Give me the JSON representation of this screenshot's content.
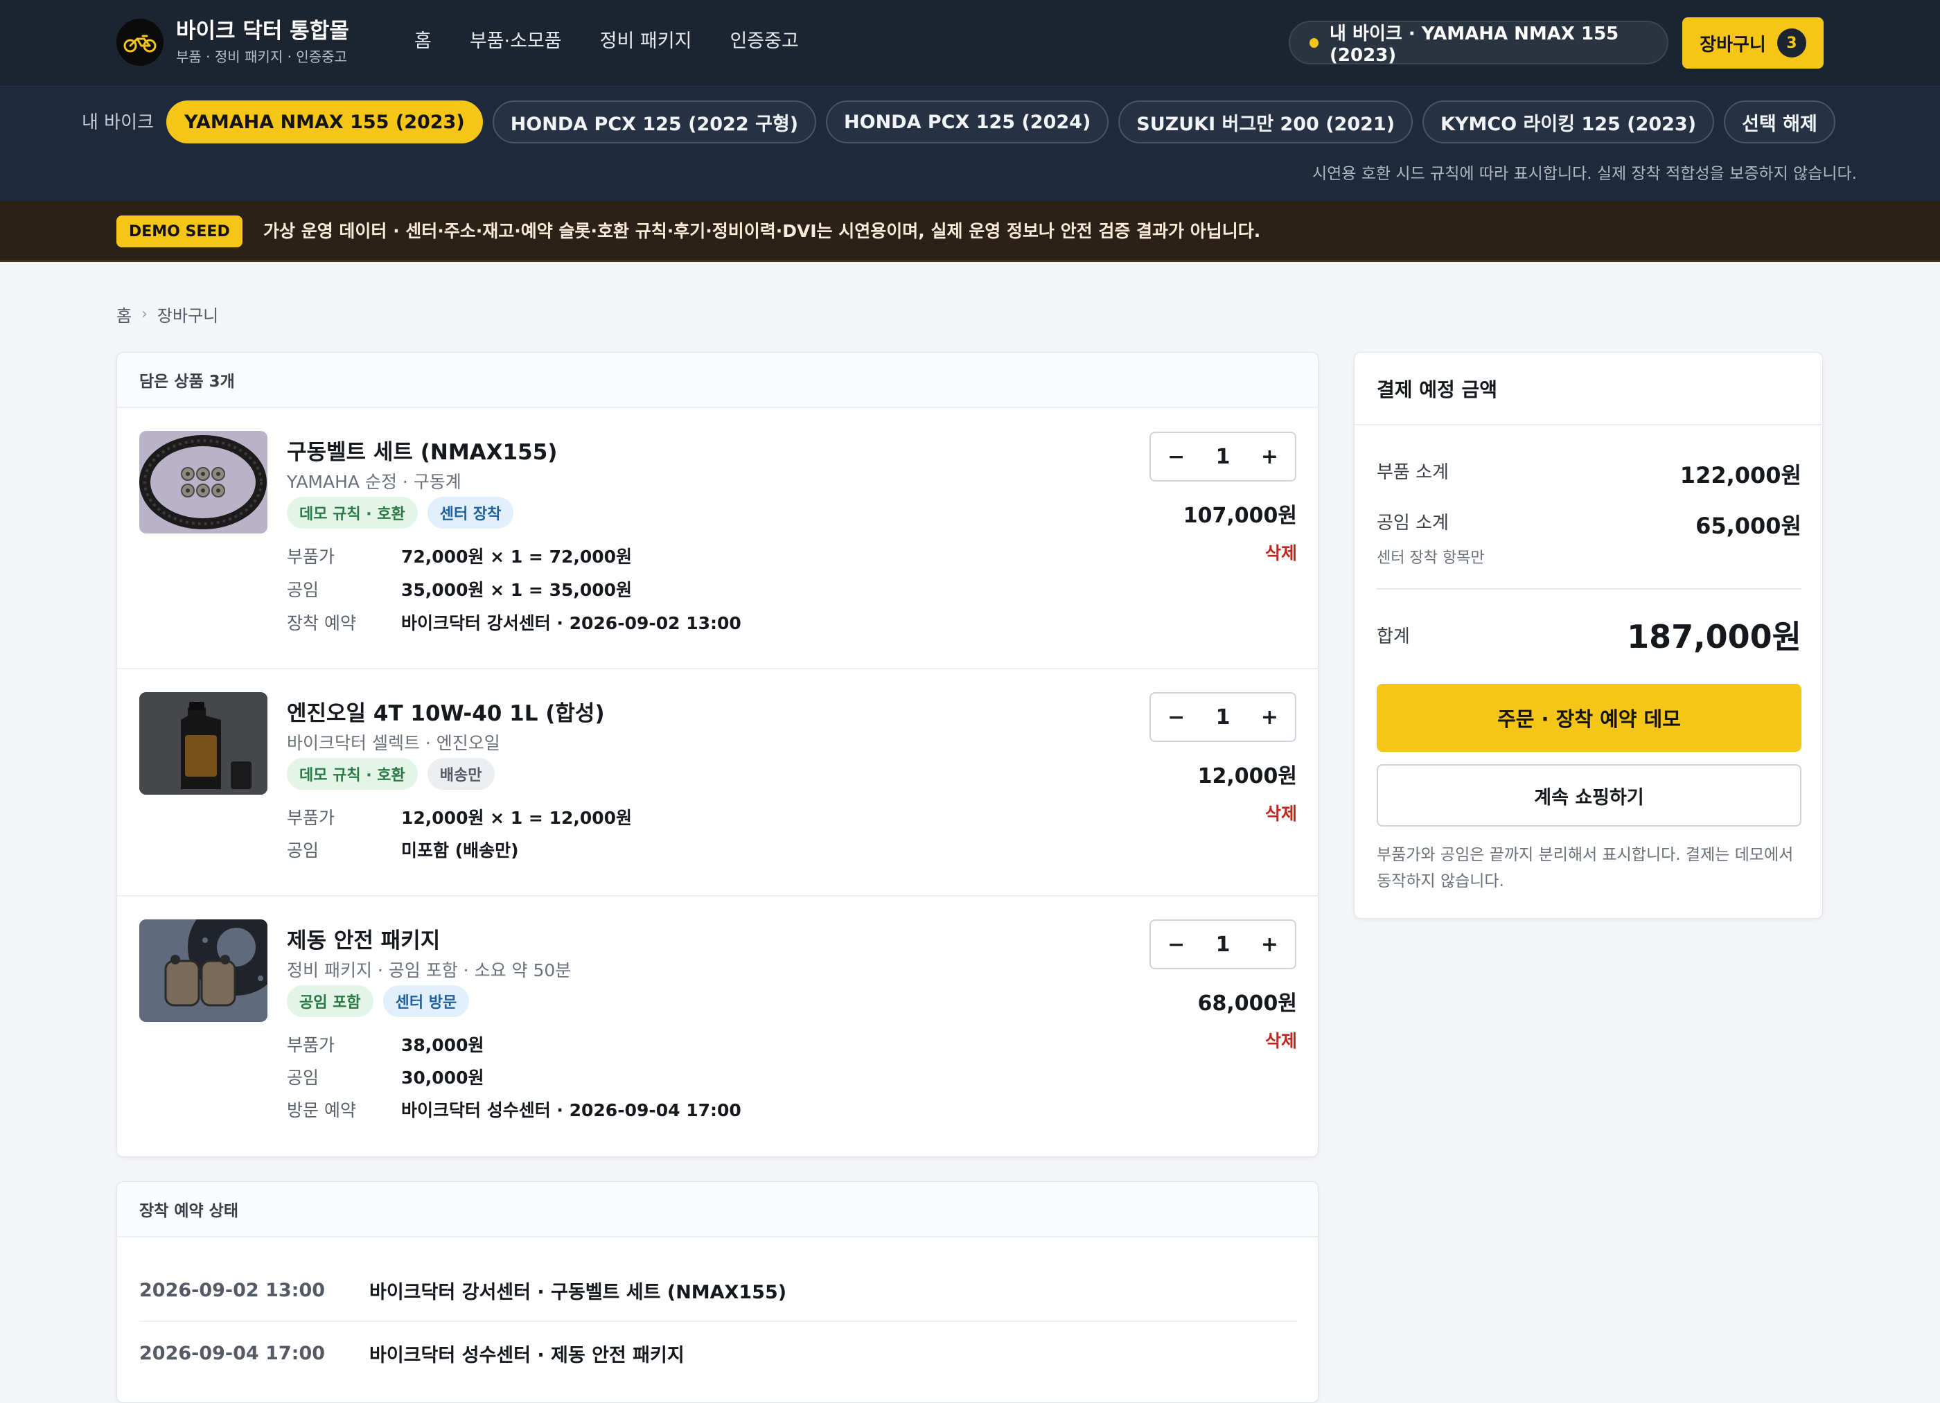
{
  "header": {
    "brand_title": "바이크 닥터 통합몰",
    "brand_sub": "부품 · 정비 패키지 · 인증중고",
    "nav": [
      "홈",
      "부품·소모품",
      "정비 패키지",
      "인증중고"
    ],
    "my_bike_pill": "내 바이크 · YAMAHA NMAX 155 (2023)",
    "cart_label": "장바구니",
    "cart_count": "3"
  },
  "bike_bar": {
    "label": "내 바이크",
    "chips": [
      {
        "label": "YAMAHA NMAX 155 (2023)",
        "active": true
      },
      {
        "label": "HONDA PCX 125 (2022 구형)",
        "active": false
      },
      {
        "label": "HONDA PCX 125 (2024)",
        "active": false
      },
      {
        "label": "SUZUKI 버그만 200 (2021)",
        "active": false
      },
      {
        "label": "KYMCO 라이킹 125 (2023)",
        "active": false
      },
      {
        "label": "선택 해제",
        "active": false
      }
    ],
    "note": "시연용 호환 시드 규칙에 따라 표시합니다. 실제 장착 적합성을 보증하지 않습니다."
  },
  "banner": {
    "tag": "DEMO SEED",
    "text": "가상 운영 데이터 · 센터·주소·재고·예약 슬롯·호환 규칙·후기·정비이력·DVI는 시연용이며, 실제 운영 정보나 안전 검증 결과가 아닙니다."
  },
  "breadcrumb": [
    "홈",
    "장바구니"
  ],
  "cart": {
    "header": "담은 상품 3개",
    "items": [
      {
        "title": "구동벨트 세트 (NMAX155)",
        "sub": "YAMAHA 순정 · 구동계",
        "tags": [
          "데모 규칙 · 호환",
          "센터 장착"
        ],
        "rows": [
          {
            "k": "부품가",
            "v": "72,000원 × 1 = 72,000원"
          },
          {
            "k": "공임",
            "v": "35,000원 × 1 = 35,000원"
          },
          {
            "k": "장착 예약",
            "v": "바이크닥터 강서센터 · 2026-09-02 13:00"
          }
        ],
        "qty": "1",
        "price": "107,000원",
        "delete": "삭제"
      },
      {
        "title": "엔진오일 4T 10W-40 1L (합성)",
        "sub": "바이크닥터 셀렉트 · 엔진오일",
        "tags": [
          "데모 규칙 · 호환",
          "배송만"
        ],
        "rows": [
          {
            "k": "부품가",
            "v": "12,000원 × 1 = 12,000원"
          },
          {
            "k": "공임",
            "v": "미포함 (배송만)"
          }
        ],
        "qty": "1",
        "price": "12,000원",
        "delete": "삭제"
      },
      {
        "title": "제동 안전 패키지",
        "sub": "정비 패키지 · 공임 포함 · 소요 약 50분",
        "tags": [
          "공임 포함",
          "센터 방문"
        ],
        "rows": [
          {
            "k": "부품가",
            "v": "38,000원"
          },
          {
            "k": "공임",
            "v": "30,000원"
          },
          {
            "k": "방문 예약",
            "v": "바이크닥터 성수센터 · 2026-09-04 17:00"
          }
        ],
        "qty": "1",
        "price": "68,000원",
        "delete": "삭제"
      }
    ],
    "stepper_minus": "−",
    "stepper_plus": "+"
  },
  "reservations": {
    "header": "장착 예약 상태",
    "rows": [
      {
        "date": "2026-09-02 13:00",
        "desc": "바이크닥터 강서센터 · 구동벨트 세트 (NMAX155)"
      },
      {
        "date": "2026-09-04 17:00",
        "desc": "바이크닥터 성수센터 · 제동 안전 패키지"
      }
    ]
  },
  "summary": {
    "header": "결제 예정 금액",
    "parts_label": "부품 소계",
    "parts_value": "122,000원",
    "labor_label": "공임 소계",
    "labor_value": "65,000원",
    "labor_note": "센터 장착 항목만",
    "total_label": "합계",
    "total_value": "187,000원",
    "order_button": "주문 · 장착 예약 데모",
    "continue_button": "계속 쇼핑하기",
    "footnote": "부품가와 공임은 끝까지 분리해서 표시합니다. 결제는 데모에서 동작하지 않습니다."
  },
  "colors": {
    "accent": "#f5c518",
    "header_bg": "#1c2430",
    "bike_bar_bg": "#1e2a3b",
    "banner_bg": "#2c2117",
    "delete": "#c0261e"
  }
}
